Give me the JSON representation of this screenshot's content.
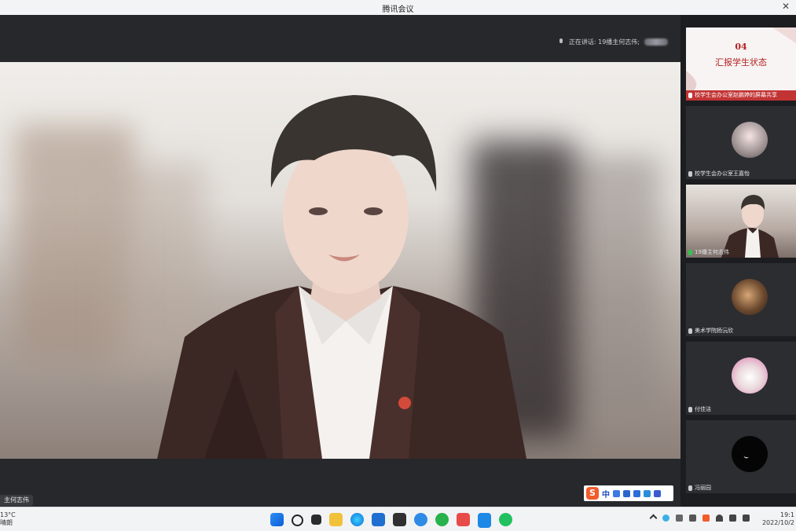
{
  "window": {
    "title": "腾讯会议"
  },
  "topbar": {
    "speaking_label": "正在讲话: 19播主何志伟;"
  },
  "main_video": {
    "name_tag": "主何志伟"
  },
  "ime": {
    "logo": "S",
    "mode": "中"
  },
  "sidebar": {
    "share_tile": {
      "number": "04",
      "title": "汇报学生状态",
      "label": "校学生会办公室赵鹏婷的屏幕共享"
    },
    "participants": [
      {
        "label": "校学生会办公室王嘉怡"
      },
      {
        "label": "19播主何志伟"
      },
      {
        "label": "美术学院杨沅欣"
      },
      {
        "label": "付佳洁"
      },
      {
        "label": "冯丽园"
      }
    ]
  },
  "taskbar": {
    "weather_temp": "13°C",
    "weather_desc": "晴朗",
    "time": "19:1",
    "date": "2022/10/2"
  }
}
